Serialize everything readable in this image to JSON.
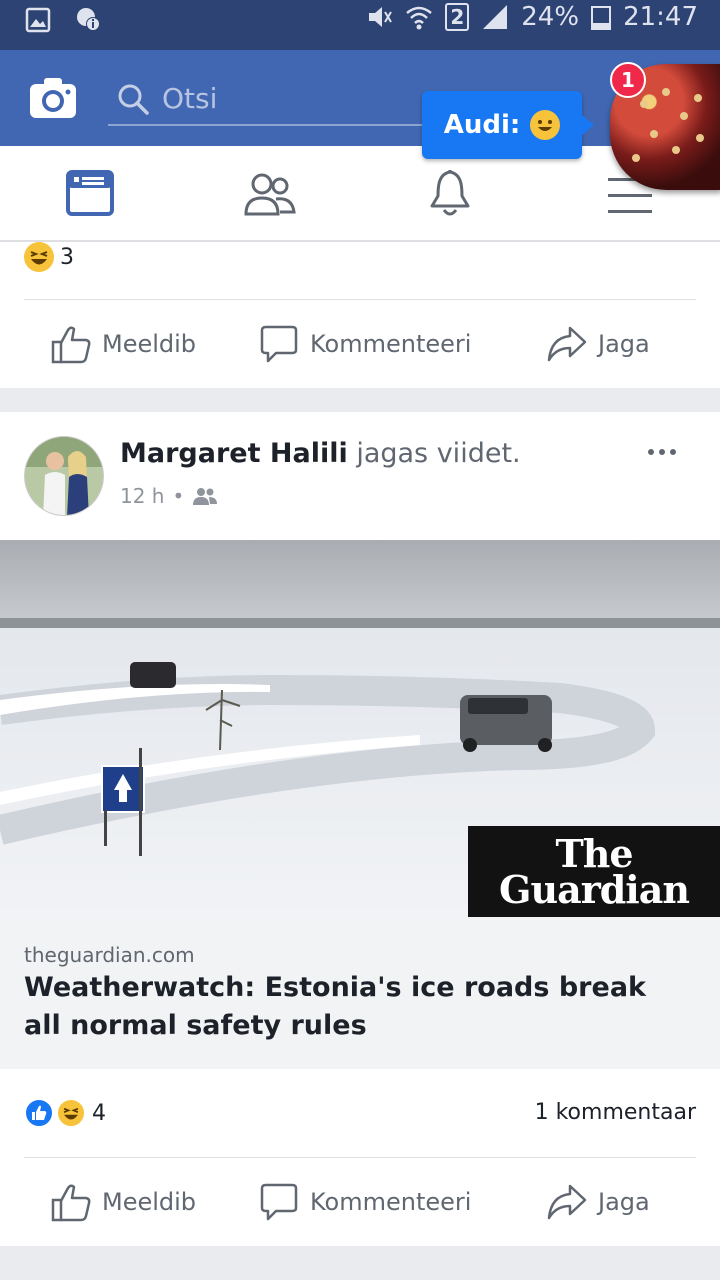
{
  "status_bar": {
    "badge_sim": "2",
    "battery": "24%",
    "time": "21:47"
  },
  "header": {
    "search_placeholder": "Otsi",
    "chat_tip_name": "Audi:",
    "chat_badge": "1"
  },
  "feed": {
    "post1": {
      "reaction_count": "3",
      "actions": {
        "like": "Meeldib",
        "comment": "Kommenteeri",
        "share": "Jaga"
      }
    },
    "post2": {
      "author": "Margaret Halili",
      "shared_text": "jagas viidet.",
      "time": "12 h",
      "dot": "•",
      "link_domain": "theguardian.com",
      "link_title": "Weatherwatch: Estonia's ice roads break all normal safety rules",
      "image_logo_line1": "The",
      "image_logo_line2": "Guardian",
      "reaction_count": "4",
      "comments": "1 kommentaar",
      "actions": {
        "like": "Meeldib",
        "comment": "Kommenteeri",
        "share": "Jaga"
      }
    }
  },
  "colors": {
    "brand_blue": "#4267b2",
    "status_bar": "#2d4373",
    "link_blue": "#1877f2"
  }
}
